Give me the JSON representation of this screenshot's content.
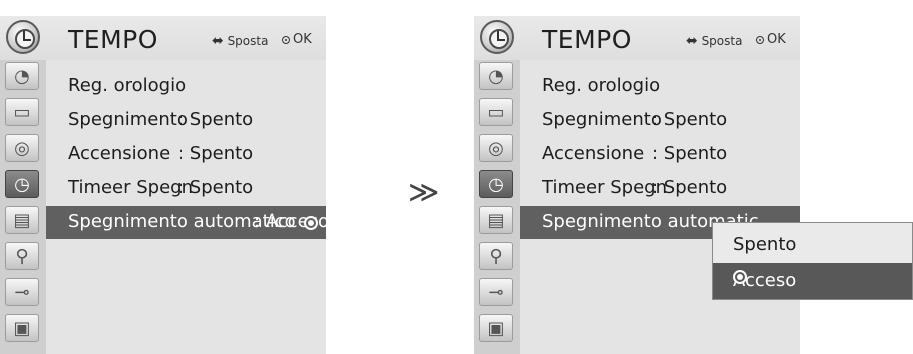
{
  "menu": {
    "title": "TEMPO",
    "nav_arrows": "◀▶▲▼",
    "nav_label": "Sposta",
    "ok_label": "OK",
    "sidebar_icons": [
      "satellite-dish-icon",
      "monitor-icon",
      "speaker-icon",
      "clock-icon",
      "calendar-icon",
      "lock-icon",
      "input-plug-icon",
      "picture-icon"
    ],
    "items": [
      {
        "label": "Reg. orologio",
        "value": ""
      },
      {
        "label": "Spegnimento",
        "value": ": Spento"
      },
      {
        "label": "Accensione",
        "value": ": Spento"
      },
      {
        "label": "Timeer Spegn",
        "value": ": Spento"
      },
      {
        "label": "Spegnimento automatico",
        "value": ": Acceso"
      }
    ],
    "right_items": [
      {
        "label": "Reg. orologio",
        "value": ""
      },
      {
        "label": "Spegnimento",
        "value": ": Spento"
      },
      {
        "label": "Accensione",
        "value": ": Spento"
      },
      {
        "label": "Timeer Spegn",
        "value": ": Spento"
      },
      {
        "label": "Spegnimento automatic",
        "value": ""
      }
    ]
  },
  "transition_arrow": "≫",
  "popup": {
    "options": [
      "Spento",
      "Acceso"
    ],
    "selected": "Acceso"
  },
  "colors": {
    "header_bg": "#e6e6e6",
    "body_bg": "#e4e4e4",
    "sidebar_bg": "#cfcfcf",
    "selected_bg": "#606060"
  }
}
